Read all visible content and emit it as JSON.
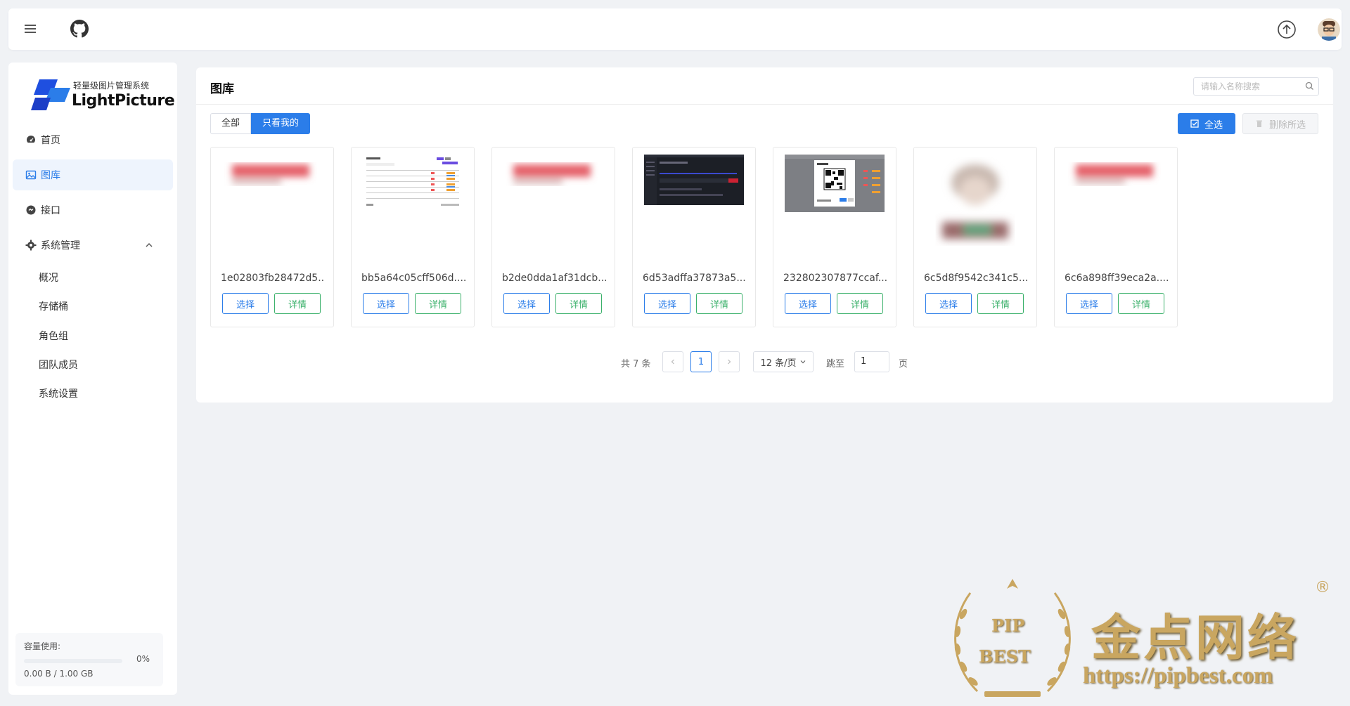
{
  "topbar": {
    "menu_icon": "menu-icon",
    "github_icon": "github-icon",
    "upload_icon": "upload-icon",
    "avatar": "user-avatar"
  },
  "sidebar": {
    "logo_tagline": "轻量级图片管理系统",
    "logo_name": "LightPicture",
    "items": [
      {
        "label": "首页",
        "icon": "dashboard-icon",
        "active": false
      },
      {
        "label": "图库",
        "icon": "image-icon",
        "active": true
      },
      {
        "label": "接口",
        "icon": "api-icon",
        "active": false
      },
      {
        "label": "系统管理",
        "icon": "gear-icon",
        "active": false,
        "expanded": true
      }
    ],
    "sub_items": [
      "概况",
      "存储桶",
      "角色组",
      "团队成员",
      "系统设置"
    ],
    "usage": {
      "label": "容量使用:",
      "percent_text": "0%",
      "percent": 0,
      "capacity": "0.00 B / 1.00 GB"
    }
  },
  "main": {
    "title": "图库",
    "search_placeholder": "请输入名称搜索",
    "filter_tabs": [
      "全部",
      "只看我的"
    ],
    "active_filter": "只看我的",
    "select_all_label": "全选",
    "delete_label": "删除所选",
    "images": [
      {
        "name": "1e02803fb28472d5...",
        "kind": "blur-red"
      },
      {
        "name": "bb5a64c05cff506d....",
        "kind": "table-light"
      },
      {
        "name": "b2de0dda1af31dcb...",
        "kind": "blur-red"
      },
      {
        "name": "6d53adffa37873a5....",
        "kind": "dark-ui"
      },
      {
        "name": "232802307877ccaf....",
        "kind": "qr-modal"
      },
      {
        "name": "6c5d8f9542c341c5....",
        "kind": "blur-portrait"
      },
      {
        "name": "6c6a898ff39eca2a....",
        "kind": "blur-red"
      }
    ],
    "select_btn": "选择",
    "detail_btn": "详情",
    "pagination": {
      "total_text": "共 7 条",
      "current_page": "1",
      "page_size": "12 条/页",
      "goto_label": "跳至",
      "goto_value": "1",
      "page_unit": "页"
    }
  },
  "watermark": {
    "cn": "金点网络",
    "url": "https://pipbest.com",
    "seal_top": "PIP",
    "seal_bottom": "BEST",
    "reg": "®"
  },
  "colors": {
    "primary": "#2b7de9",
    "success": "#3bb16b",
    "bg": "#f0f2f5"
  }
}
